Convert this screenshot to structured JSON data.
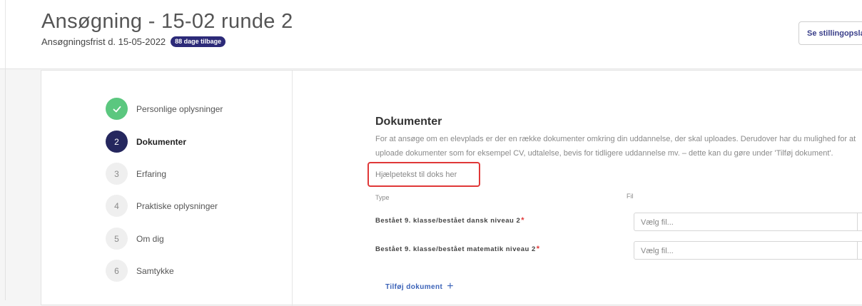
{
  "header": {
    "title": "Ansøgning - 15-02 runde 2",
    "deadline_text": "Ansøgningsfrist d. 15-05-2022",
    "deadline_badge": "88 dage tilbage",
    "job_posting_button": "Se stillingopslag"
  },
  "steps": [
    {
      "number": "",
      "label": "Personlige oplysninger",
      "state": "done",
      "icon": "check-icon"
    },
    {
      "number": "2",
      "label": "Dokumenter",
      "state": "active"
    },
    {
      "number": "3",
      "label": "Erfaring",
      "state": "pending"
    },
    {
      "number": "4",
      "label": "Praktiske oplysninger",
      "state": "pending"
    },
    {
      "number": "5",
      "label": "Om dig",
      "state": "pending"
    },
    {
      "number": "6",
      "label": "Samtykke",
      "state": "pending"
    }
  ],
  "section": {
    "title": "Dokumenter",
    "description": "For at ansøge om en elevplads er der en række dokumenter omkring din uddannelse, der skal uploades. Derudover har du mulighed for at uploade dokumenter som for eksempel CV, udtalelse, bevis for tidligere uddannelse mv. – dette kan du gøre under 'Tilføj dokument'.",
    "help_text": "Hjælpetekst til doks her",
    "col_type": "Type",
    "col_file": "Fil",
    "documents": [
      {
        "label": "Bestået 9. klasse/bestået dansk niveau 2",
        "required_mark": "*",
        "file_placeholder": "Vælg fil..."
      },
      {
        "label": "Bestået 9. klasse/bestået matematik niveau 2",
        "required_mark": "*",
        "file_placeholder": "Vælg fil..."
      }
    ],
    "add_document_label": "Tilføj dokument"
  },
  "colors": {
    "accent": "#25275e",
    "done": "#5bc77f",
    "badge": "#2c2a78",
    "highlight_border": "#e03838",
    "link": "#3c63b8"
  }
}
